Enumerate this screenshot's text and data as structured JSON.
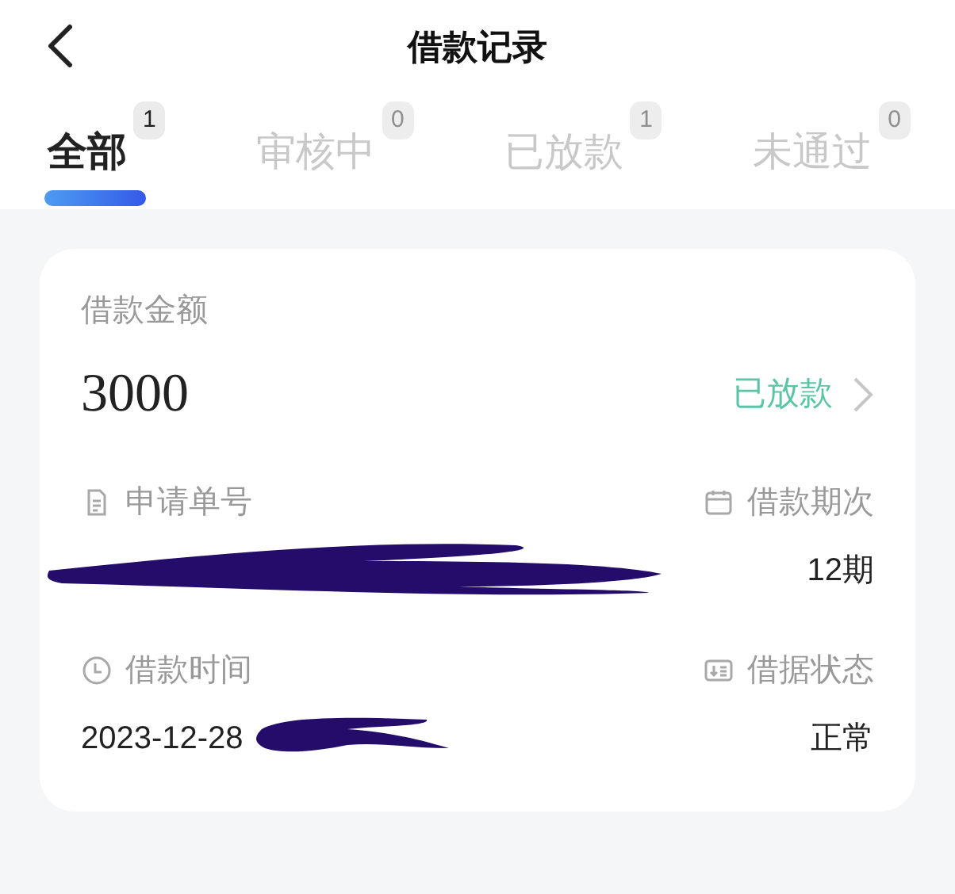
{
  "header": {
    "title": "借款记录"
  },
  "tabs": [
    {
      "label": "全部",
      "count": "1",
      "selected": true
    },
    {
      "label": "审核中",
      "count": "0",
      "selected": false
    },
    {
      "label": "已放款",
      "count": "1",
      "selected": false
    },
    {
      "label": "未通过",
      "count": "0",
      "selected": false
    }
  ],
  "record": {
    "amount_label": "借款金额",
    "amount": "3000",
    "status": "已放款",
    "fields": [
      {
        "kind": "document",
        "label": "申请单号",
        "redacted": true
      },
      {
        "kind": "calendar",
        "label": "借款期次",
        "value": "12期",
        "redacted": false
      },
      {
        "kind": "clock",
        "label": "借款时间",
        "value": "2023-12-28",
        "redacted": true
      },
      {
        "kind": "receipt",
        "label": "借据状态",
        "value": "正常",
        "redacted": false
      }
    ]
  }
}
